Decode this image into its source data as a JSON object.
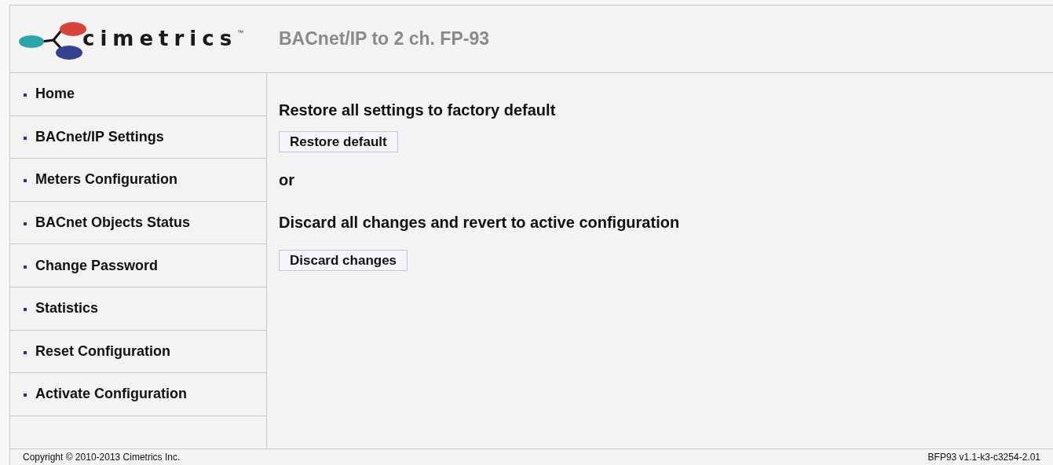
{
  "header": {
    "logo_text": "cimetrics",
    "logo_mark": "™",
    "title": "BACnet/IP to 2 ch. FP-93"
  },
  "sidebar": {
    "items": [
      "Home",
      "BACnet/IP Settings",
      "Meters Configuration",
      "BACnet Objects Status",
      "Change Password",
      "Statistics",
      "Reset Configuration",
      "Activate Configuration"
    ]
  },
  "content": [
    {
      "kind": "heading",
      "text": "Restore all settings to factory default"
    },
    {
      "kind": "button",
      "text": "Restore default"
    },
    {
      "kind": "heading",
      "text": "or"
    },
    {
      "kind": "heading",
      "text": "Discard all changes and revert to active configuration"
    },
    {
      "kind": "button",
      "text": "Discard changes"
    }
  ],
  "footer": {
    "copyright": "Copyright © 2010-2013 Cimetrics Inc.",
    "version": "BFP93 v1.1-k3-c3254-2.01"
  }
}
